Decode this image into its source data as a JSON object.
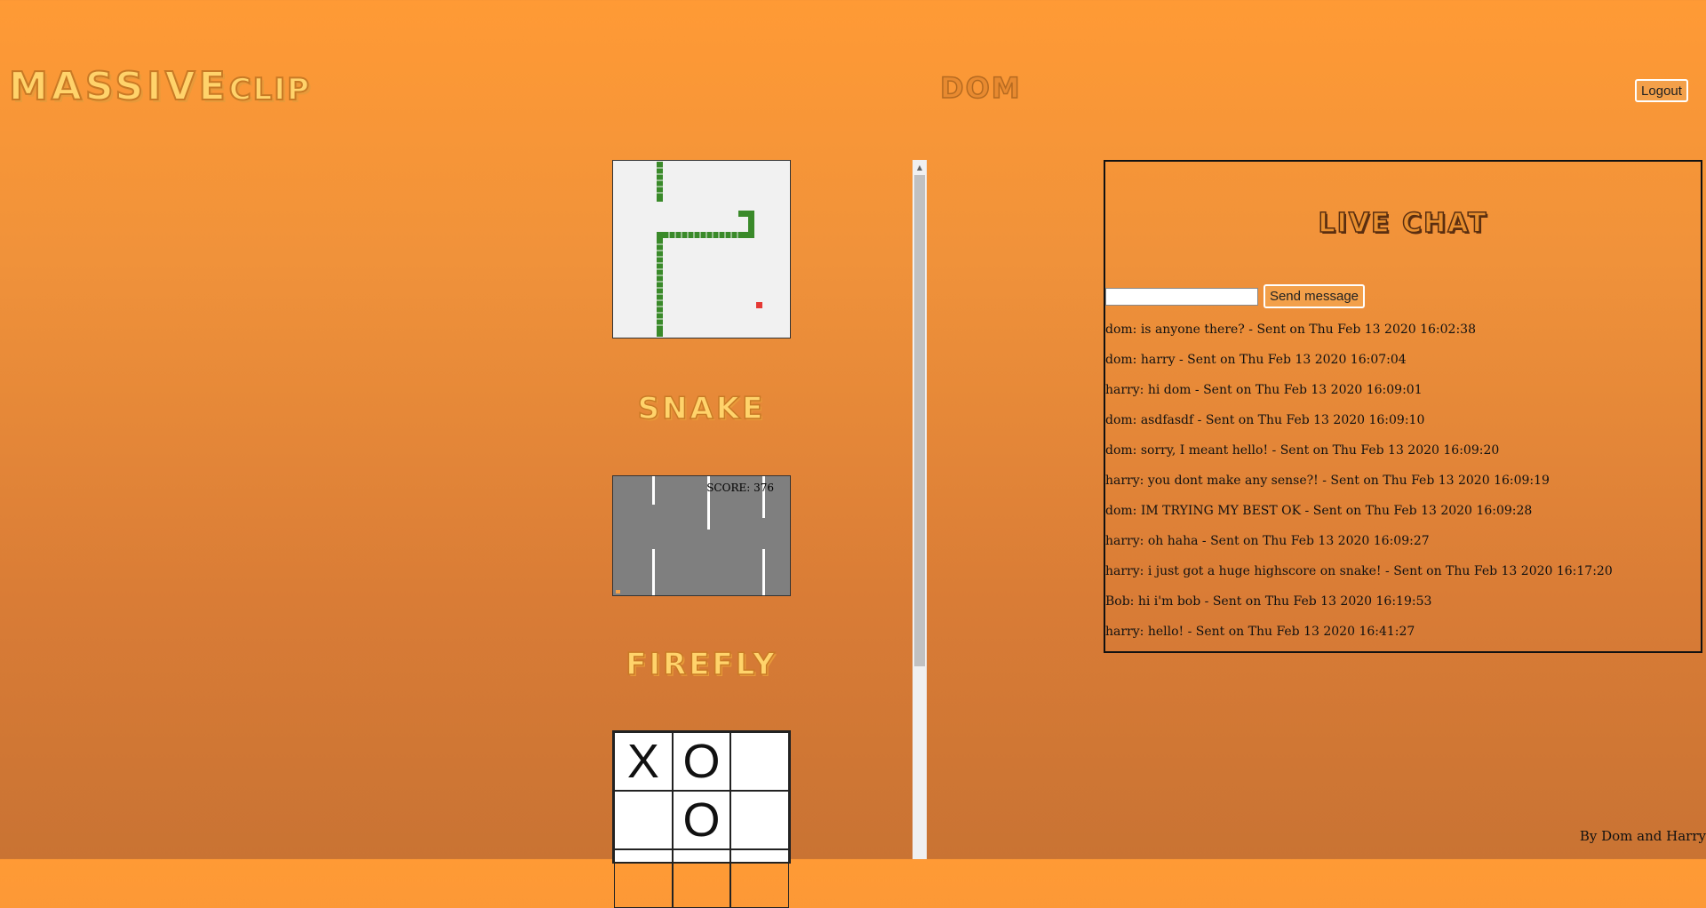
{
  "header": {
    "logo_big": "MASSIVE",
    "logo_small": "CLIP",
    "username": "DOM",
    "logout_label": "Logout"
  },
  "games": {
    "snake_title": "SNAKE",
    "firefly_title": "FIREFLY",
    "firefly_score": "SCORE: 376",
    "tictactoe": [
      "X",
      "O",
      "",
      "",
      "O",
      "",
      "",
      "",
      ""
    ]
  },
  "chat": {
    "title": "LIVE CHAT",
    "input_value": "",
    "send_label": "Send message",
    "messages": [
      "dom: is anyone there? - Sent on Thu Feb 13 2020 16:02:38",
      "dom: harry - Sent on Thu Feb 13 2020 16:07:04",
      "harry: hi dom - Sent on Thu Feb 13 2020 16:09:01",
      "dom: asdfasdf - Sent on Thu Feb 13 2020 16:09:10",
      "dom: sorry, I meant hello! - Sent on Thu Feb 13 2020 16:09:20",
      "harry: you dont make any sense?! - Sent on Thu Feb 13 2020 16:09:19",
      "dom: IM TRYING MY BEST OK - Sent on Thu Feb 13 2020 16:09:28",
      "harry: oh haha - Sent on Thu Feb 13 2020 16:09:27",
      "harry: i just got a huge highscore on snake! - Sent on Thu Feb 13 2020 16:17:20",
      "Bob: hi i'm bob - Sent on Thu Feb 13 2020 16:19:53",
      "harry: hello! - Sent on Thu Feb 13 2020 16:41:27"
    ]
  },
  "footer": {
    "credit": "By Dom and Harry"
  },
  "colors": {
    "snake_body": "#3a8a2a",
    "food": "#e53935",
    "logo_fill": "#ffd36b"
  }
}
